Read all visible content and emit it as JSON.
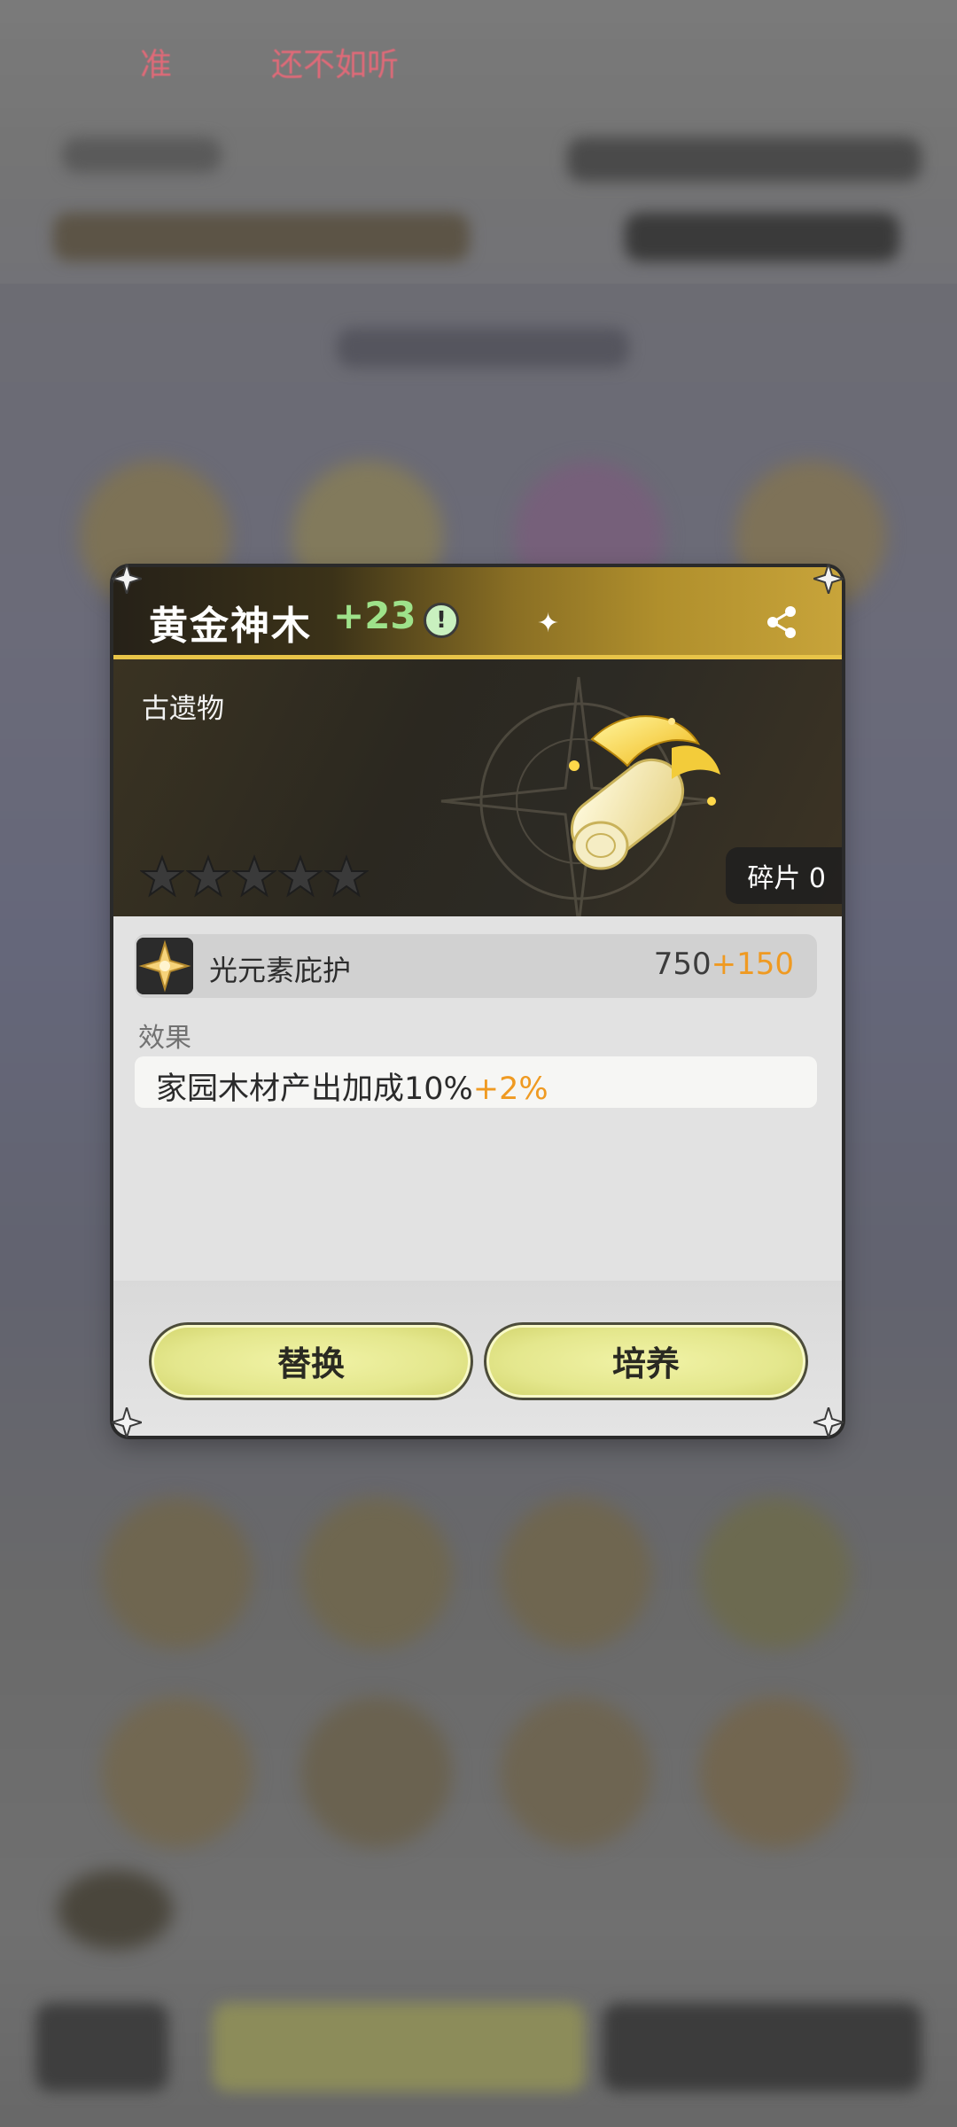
{
  "background": {
    "ticker_left": "准",
    "ticker_right": "还不如听"
  },
  "dialog": {
    "title": "黄金神木",
    "level": "+23",
    "info_icon": "info-icon",
    "sparkle_icon": "sparkle-icon",
    "share_icon": "share-icon",
    "category": "古遗物",
    "stars_total": 5,
    "stars_filled": 0,
    "shards_text": "碎片 0",
    "stat": {
      "icon": "light-element-icon",
      "label": "光元素庇护",
      "value": "750",
      "bonus": "+150"
    },
    "effect_heading": "效果",
    "effect": {
      "text": "家园木材产出加成10%",
      "bonus": "+2%"
    },
    "buttons": {
      "replace": "替换",
      "cultivate": "培养"
    }
  },
  "colors": {
    "accent_gold": "#e8c448",
    "level_green": "#9ee28a",
    "bonus_orange": "#ef9a22",
    "button_fill": "#e4e78d"
  }
}
